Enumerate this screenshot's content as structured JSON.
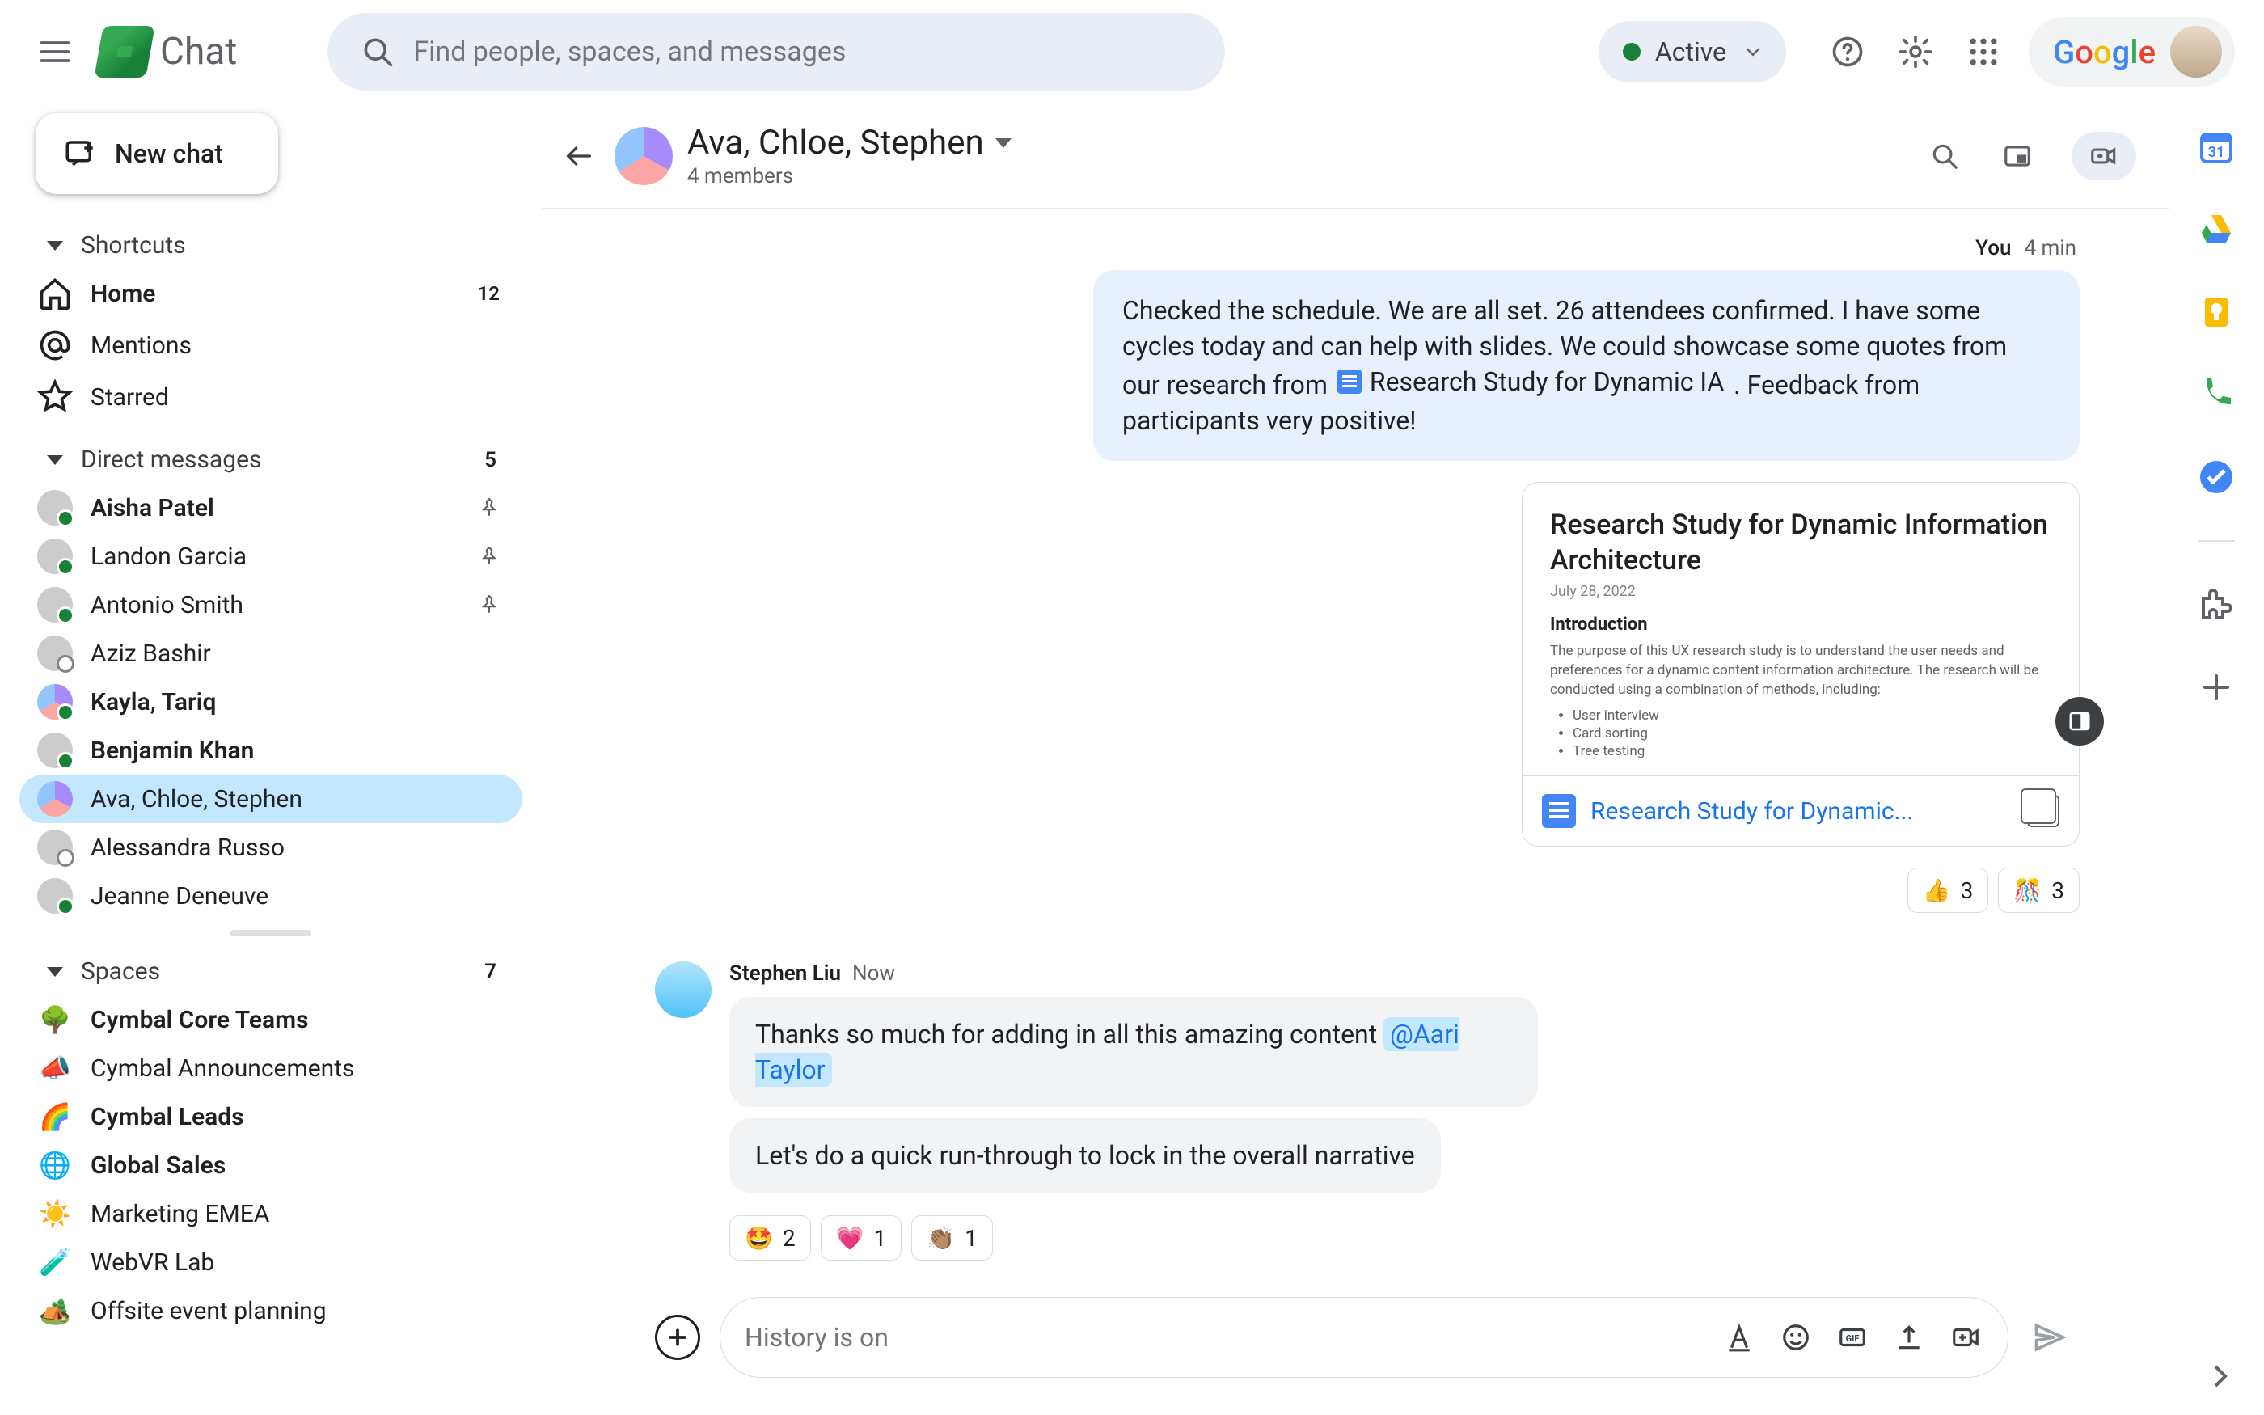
{
  "topbar": {
    "app_name": "Chat",
    "search_placeholder": "Find people, spaces, and messages",
    "status_label": "Active",
    "brand_word": "Google"
  },
  "sidebar": {
    "new_chat_label": "New chat",
    "sections": {
      "shortcuts": {
        "label": "Shortcuts"
      },
      "dms": {
        "label": "Direct messages",
        "badge": "5"
      },
      "spaces": {
        "label": "Spaces",
        "badge": "7"
      }
    },
    "nav": {
      "home": {
        "label": "Home",
        "badge": "12"
      },
      "mentions": {
        "label": "Mentions"
      },
      "starred": {
        "label": "Starred"
      }
    },
    "dms": [
      {
        "label": "Aisha Patel",
        "bold": true,
        "presence": "online",
        "pinned": true
      },
      {
        "label": "Landon Garcia",
        "bold": false,
        "presence": "online",
        "pinned": true
      },
      {
        "label": "Antonio Smith",
        "bold": false,
        "presence": "online",
        "pinned": true
      },
      {
        "label": "Aziz Bashir",
        "bold": false,
        "presence": "away",
        "pinned": false
      },
      {
        "label": "Kayla, Tariq",
        "bold": true,
        "presence": "online",
        "pinned": false,
        "group": true
      },
      {
        "label": "Benjamin Khan",
        "bold": true,
        "presence": "online",
        "pinned": false
      },
      {
        "label": "Ava, Chloe, Stephen",
        "bold": false,
        "presence": "none",
        "pinned": false,
        "group": true,
        "selected": true
      },
      {
        "label": "Alessandra Russo",
        "bold": false,
        "presence": "away",
        "pinned": false
      },
      {
        "label": "Jeanne Deneuve",
        "bold": false,
        "presence": "online",
        "pinned": false
      }
    ],
    "spaces_list": [
      {
        "emoji": "🌳",
        "label": "Cymbal Core Teams",
        "bold": true
      },
      {
        "emoji": "📣",
        "label": "Cymbal Announcements",
        "bold": false
      },
      {
        "emoji": "🌈",
        "label": "Cymbal Leads",
        "bold": true
      },
      {
        "emoji": "🌐",
        "label": "Global Sales",
        "bold": true
      },
      {
        "emoji": "☀️",
        "label": "Marketing EMEA",
        "bold": false
      },
      {
        "emoji": "🧪",
        "label": "WebVR Lab",
        "bold": false
      },
      {
        "emoji": "🏕️",
        "label": "Offsite event planning",
        "bold": false
      }
    ]
  },
  "conversation": {
    "title": "Ava, Chloe, Stephen",
    "subtitle": "4 members",
    "self_meta": {
      "who": "You",
      "time": "4 min"
    },
    "self_text_1": "Checked the schedule.  We are all set.  26 attendees confirmed. I have some cycles today and can help with slides.  We could showcase some quotes from our research from ",
    "self_doc_chip": "Research Study for Dynamic IA",
    "self_text_2": " . Feedback from participants very positive!",
    "doc_card": {
      "title": "Research Study for Dynamic Information Architecture",
      "date": "July 28, 2022",
      "heading": "Introduction",
      "paragraph": "The purpose of this UX research study is to understand the user needs and preferences for a dynamic content information architecture. The research will be conducted using a combination of methods, including:",
      "bullets": [
        "User interview",
        "Card sorting",
        "Tree testing"
      ],
      "footer_title": "Research Study for Dynamic..."
    },
    "reactions_self": [
      {
        "emoji": "👍",
        "count": "3"
      },
      {
        "emoji": "🎊",
        "count": "3"
      }
    ],
    "other": {
      "name": "Stephen Liu",
      "time": "Now",
      "line1_pre": "Thanks so much for adding in all this amazing content ",
      "mention": "@Aari Taylor",
      "line2": "Let's do a quick run-through to lock in the overall narrative"
    },
    "reactions_other": [
      {
        "emoji": "🤩",
        "count": "2"
      },
      {
        "emoji": "💗",
        "count": "1"
      },
      {
        "emoji": "👏🏽",
        "count": "1"
      }
    ],
    "compose_placeholder": "History is on"
  }
}
